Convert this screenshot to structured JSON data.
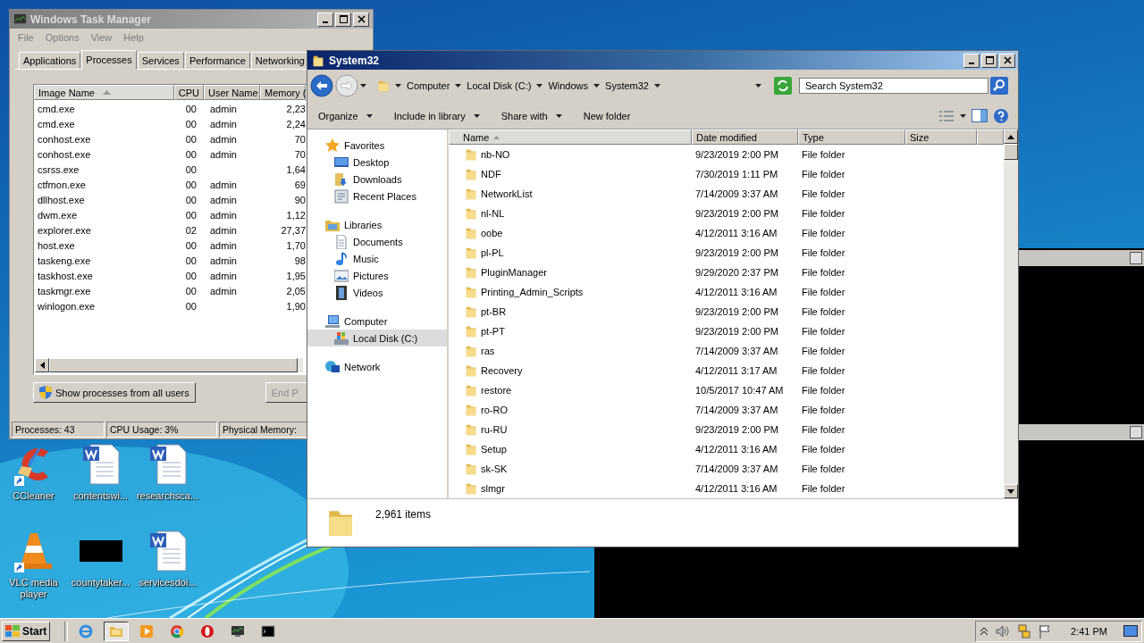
{
  "task_manager": {
    "title": "Windows Task Manager",
    "menu": [
      "File",
      "Options",
      "View",
      "Help"
    ],
    "tabs": [
      {
        "label": "Applications",
        "selected": false
      },
      {
        "label": "Processes",
        "selected": true
      },
      {
        "label": "Services",
        "selected": false
      },
      {
        "label": "Performance",
        "selected": false
      },
      {
        "label": "Networking",
        "selected": false
      }
    ],
    "columns": [
      {
        "label": "Image Name",
        "sorted": true
      },
      {
        "label": "CPU",
        "sorted": false
      },
      {
        "label": "User Name",
        "sorted": false
      },
      {
        "label": "Memory (",
        "sorted": false
      }
    ],
    "rows": [
      {
        "image": "cmd.exe",
        "cpu": "00",
        "user": "admin",
        "memory": "2,23"
      },
      {
        "image": "cmd.exe",
        "cpu": "00",
        "user": "admin",
        "memory": "2,24"
      },
      {
        "image": "conhost.exe",
        "cpu": "00",
        "user": "admin",
        "memory": "70"
      },
      {
        "image": "conhost.exe",
        "cpu": "00",
        "user": "admin",
        "memory": "70"
      },
      {
        "image": "csrss.exe",
        "cpu": "00",
        "user": "",
        "memory": "1,64"
      },
      {
        "image": "ctfmon.exe",
        "cpu": "00",
        "user": "admin",
        "memory": "69"
      },
      {
        "image": "dllhost.exe",
        "cpu": "00",
        "user": "admin",
        "memory": "90"
      },
      {
        "image": "dwm.exe",
        "cpu": "00",
        "user": "admin",
        "memory": "1,12"
      },
      {
        "image": "explorer.exe",
        "cpu": "02",
        "user": "admin",
        "memory": "27,37"
      },
      {
        "image": "host.exe",
        "cpu": "00",
        "user": "admin",
        "memory": "1,70"
      },
      {
        "image": "taskeng.exe",
        "cpu": "00",
        "user": "admin",
        "memory": "98"
      },
      {
        "image": "taskhost.exe",
        "cpu": "00",
        "user": "admin",
        "memory": "1,95"
      },
      {
        "image": "taskmgr.exe",
        "cpu": "00",
        "user": "admin",
        "memory": "2,05"
      },
      {
        "image": "winlogon.exe",
        "cpu": "00",
        "user": "",
        "memory": "1,90"
      }
    ],
    "show_all_button": "Show processes from all users",
    "end_button": {
      "label": "End P",
      "disabled": true
    },
    "status": [
      "Processes: 43",
      "CPU Usage: 3%",
      "Physical Memory:"
    ]
  },
  "explorer": {
    "title": "System32",
    "breadcrumb": [
      "Computer",
      "Local Disk (C:)",
      "Windows",
      "System32"
    ],
    "search_placeholder": "Search System32",
    "toolbar": [
      {
        "label": "Organize",
        "dropdown": true
      },
      {
        "label": "Include in library",
        "dropdown": true
      },
      {
        "label": "Share with",
        "dropdown": true
      },
      {
        "label": "New folder",
        "dropdown": false
      }
    ],
    "nav": [
      {
        "label": "Favorites",
        "kind": "star",
        "selected": false,
        "children": [
          {
            "label": "Desktop",
            "kind": "desktop",
            "selected": false
          },
          {
            "label": "Downloads",
            "kind": "downloads",
            "selected": false
          },
          {
            "label": "Recent Places",
            "kind": "recent",
            "selected": false
          }
        ]
      },
      {
        "label": "Libraries",
        "kind": "library",
        "selected": false,
        "children": [
          {
            "label": "Documents",
            "kind": "document",
            "selected": false
          },
          {
            "label": "Music",
            "kind": "music",
            "selected": false
          },
          {
            "label": "Pictures",
            "kind": "pictures",
            "selected": false
          },
          {
            "label": "Videos",
            "kind": "videos",
            "selected": false
          }
        ]
      },
      {
        "label": "Computer",
        "kind": "computer",
        "selected": false,
        "children": [
          {
            "label": "Local Disk (C:)",
            "kind": "disk",
            "selected": true
          }
        ]
      },
      {
        "label": "Network",
        "kind": "network",
        "selected": false
      }
    ],
    "columns": [
      {
        "label": "Name",
        "sorted": true
      },
      {
        "label": "Date modified",
        "sorted": false
      },
      {
        "label": "Type",
        "sorted": false
      },
      {
        "label": "Size",
        "sorted": false
      }
    ],
    "rows": [
      {
        "name": "nb-NO",
        "date": "9/23/2019 2:00 PM",
        "type": "File folder"
      },
      {
        "name": "NDF",
        "date": "7/30/2019 1:11 PM",
        "type": "File folder"
      },
      {
        "name": "NetworkList",
        "date": "7/14/2009 3:37 AM",
        "type": "File folder"
      },
      {
        "name": "nl-NL",
        "date": "9/23/2019 2:00 PM",
        "type": "File folder"
      },
      {
        "name": "oobe",
        "date": "4/12/2011 3:16 AM",
        "type": "File folder"
      },
      {
        "name": "pl-PL",
        "date": "9/23/2019 2:00 PM",
        "type": "File folder"
      },
      {
        "name": "PluginManager",
        "date": "9/29/2020 2:37 PM",
        "type": "File folder"
      },
      {
        "name": "Printing_Admin_Scripts",
        "date": "4/12/2011 3:16 AM",
        "type": "File folder"
      },
      {
        "name": "pt-BR",
        "date": "9/23/2019 2:00 PM",
        "type": "File folder"
      },
      {
        "name": "pt-PT",
        "date": "9/23/2019 2:00 PM",
        "type": "File folder"
      },
      {
        "name": "ras",
        "date": "7/14/2009 3:37 AM",
        "type": "File folder"
      },
      {
        "name": "Recovery",
        "date": "4/12/2011 3:17 AM",
        "type": "File folder"
      },
      {
        "name": "restore",
        "date": "10/5/2017 10:47 AM",
        "type": "File folder"
      },
      {
        "name": "ro-RO",
        "date": "7/14/2009 3:37 AM",
        "type": "File folder"
      },
      {
        "name": "ru-RU",
        "date": "9/23/2019 2:00 PM",
        "type": "File folder"
      },
      {
        "name": "Setup",
        "date": "4/12/2011 3:16 AM",
        "type": "File folder"
      },
      {
        "name": "sk-SK",
        "date": "7/14/2009 3:37 AM",
        "type": "File folder"
      },
      {
        "name": "slmgr",
        "date": "4/12/2011 3:16 AM",
        "type": "File folder"
      }
    ],
    "item_count": "2,961 items"
  },
  "desktop_icons": [
    {
      "label": "CCleaner",
      "kind": "ccleaner",
      "shortcut": true
    },
    {
      "label": "contentswi...",
      "kind": "word",
      "shortcut": false
    },
    {
      "label": "researchsca...",
      "kind": "word",
      "shortcut": false
    },
    {
      "label": "VLC media player",
      "kind": "vlc",
      "shortcut": true
    },
    {
      "label": "countytaker...",
      "kind": "black",
      "shortcut": false
    },
    {
      "label": "servicesdoi...",
      "kind": "word",
      "shortcut": false
    }
  ],
  "taskbar": {
    "start": "Start",
    "apps": [
      {
        "kind": "ie",
        "selected": false
      },
      {
        "kind": "explorer",
        "selected": true
      },
      {
        "kind": "media",
        "selected": false
      },
      {
        "kind": "chrome",
        "selected": false
      },
      {
        "kind": "opera",
        "selected": false
      },
      {
        "kind": "taskmgr",
        "selected": false
      },
      {
        "kind": "cmd",
        "selected": false
      }
    ],
    "clock": "2:41 PM"
  }
}
